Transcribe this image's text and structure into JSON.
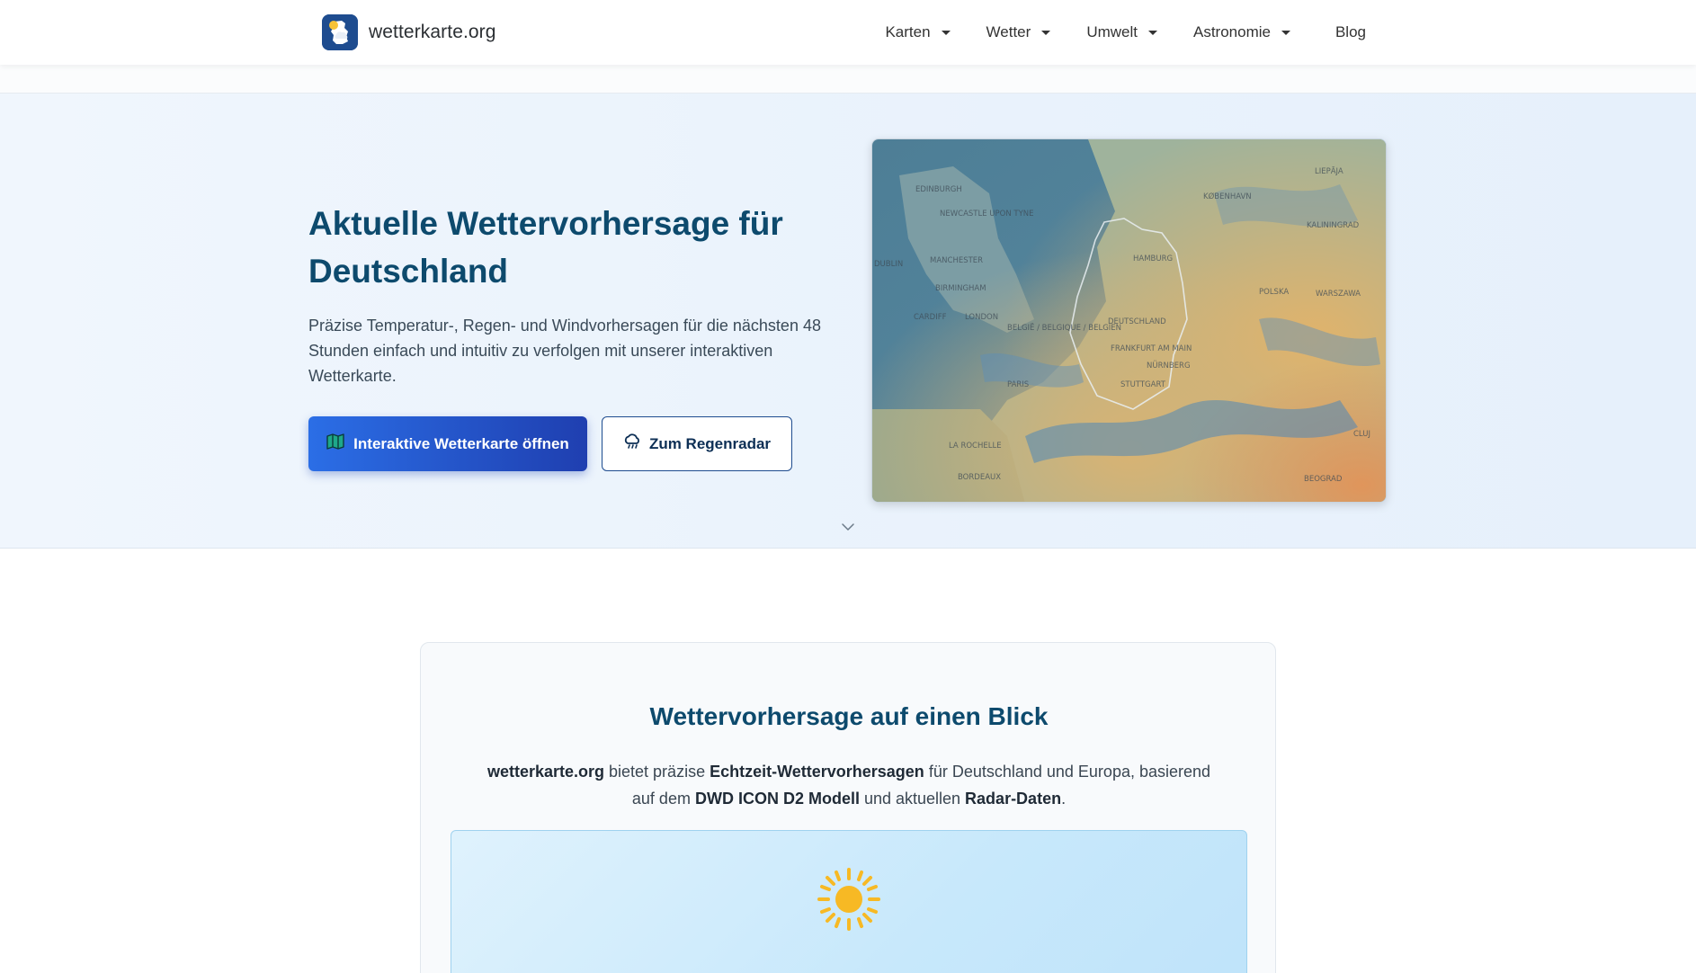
{
  "brand": {
    "name": "wetterkarte.org"
  },
  "nav": {
    "items": [
      {
        "label": "Karten"
      },
      {
        "label": "Wetter"
      },
      {
        "label": "Umwelt"
      },
      {
        "label": "Astronomie"
      }
    ],
    "blog_label": "Blog"
  },
  "hero": {
    "title": "Aktuelle Wettervorhersage für Deutschland",
    "description": "Präzise Temperatur-, Regen- und Windvorhersagen für die nächsten 48 Stunden einfach und intuitiv zu verfolgen mit unserer interaktiven Wetterkarte.",
    "primary_button": "Interaktive Wetterkarte öffnen",
    "secondary_button": "Zum Regenradar",
    "map_labels": [
      "EDINBURGH",
      "NEWCASTLE UPON TYNE",
      "DUBLIN",
      "MANCHESTER",
      "BIRMINGHAM",
      "CARDIFF",
      "LONDON",
      "PARIS",
      "LA ROCHELLE",
      "BORDEAUX",
      "KØBENHAVN",
      "HAMBURG",
      "DEUTSCHLAND",
      "BELGIË / BELGIQUE / BELGIEN",
      "FRANKFURT AM MAIN",
      "NÜRNBERG",
      "STUTTGART",
      "WARSZAWA",
      "KALININGRAD",
      "LIEPĀJA",
      "POLSKA",
      "BEOGRAD",
      "CLUJ"
    ]
  },
  "intro": {
    "title": "Wettervorhersage auf einen Blick",
    "p1_b1": "wetterkarte.org",
    "p1_t1": " bietet präzise ",
    "p1_b2": "Echtzeit-Wettervorhersagen",
    "p1_t2": " für Deutschland und Europa, basierend auf dem ",
    "p1_b3": "DWD ICON D2 Modell",
    "p1_t3": " und aktuellen ",
    "p1_b4": "Radar-Daten",
    "p1_t4": "."
  },
  "colors": {
    "accent": "#0d4a6d",
    "primary_start": "#2b6ee6",
    "primary_end": "#1f3fb0",
    "sun": "#f7b924"
  },
  "icons": {
    "logo": "germany-weather-logo",
    "primary_button": "map-book-icon",
    "secondary_button": "cloud-rain-icon",
    "scroll": "chevron-down-icon",
    "weather": "sun-icon"
  }
}
